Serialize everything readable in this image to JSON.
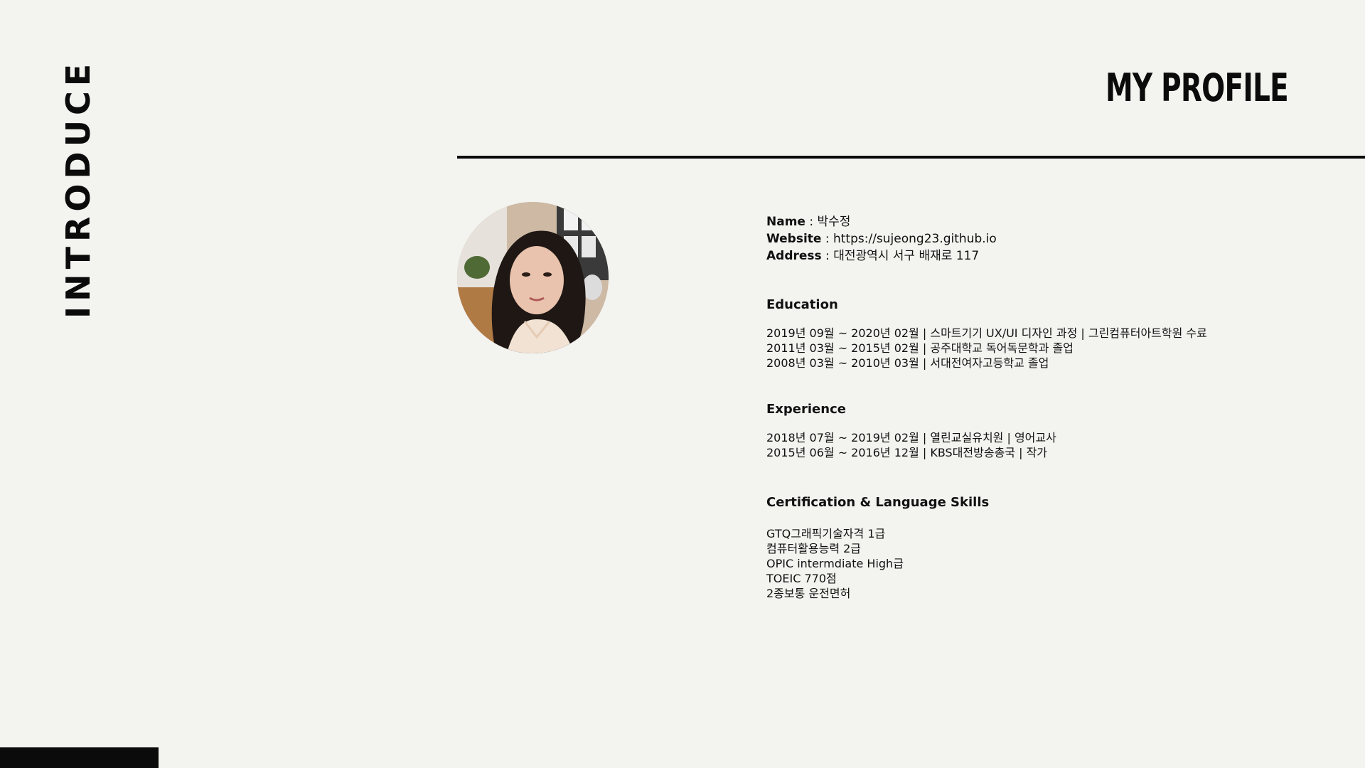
{
  "side_title": "INTRODUCE",
  "page_title": "MY PROFILE",
  "profile": {
    "name_label": "Name",
    "name_value": " : 박수정",
    "website_label": "Website",
    "website_value": " : https://sujeong23.github.io",
    "address_label": "Address",
    "address_value": " : 대전광역시 서구 배재로 117"
  },
  "education": {
    "heading": "Education",
    "entries": [
      "2019년 09월 ~ 2020년 02월 | 스마트기기 UX/UI 디자인 과정 | 그린컴퓨터아트학원 수료",
      "2011년 03월 ~ 2015년 02월 | 공주대학교 독어독문학과 졸업",
      "2008년 03월 ~ 2010년 03월 | 서대전여자고등학교 졸업"
    ]
  },
  "experience": {
    "heading": "Experience",
    "entries": [
      "2018년 07월 ~ 2019년 02월 | 열린교실유치원 | 영어교사",
      "2015년 06월 ~ 2016년 12월 | KBS대전방송총국 | 작가"
    ]
  },
  "certification": {
    "heading": "Certification & Language Skills",
    "entries": [
      "GTQ그래픽기술자격 1급",
      "컴퓨터활용능력 2급",
      "OPIC intermdiate High급",
      "TOEIC 770점",
      "2종보통 운전면허"
    ]
  },
  "colors": {
    "background": "#f3f3f0",
    "text": "#111111",
    "accent": "#0b0b0b"
  }
}
